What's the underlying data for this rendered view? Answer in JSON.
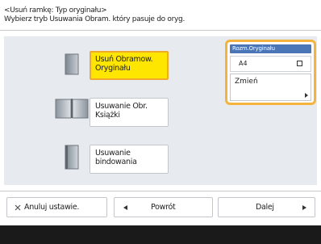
{
  "header": {
    "line1": "<Usuń ramkę: Typ oryginału>",
    "line2": "Wybierz tryb Usuwania Obram. który pasuje do oryg."
  },
  "modes": [
    {
      "line1": "Usuń Obramow.",
      "line2": "Oryginału",
      "selected": true
    },
    {
      "line1": "Usuwanie Obr.",
      "line2": "Książki",
      "selected": false
    },
    {
      "line1": "Usuwanie",
      "line2": "bindowania",
      "selected": false
    }
  ],
  "info": {
    "title": "Rozm.Oryginału",
    "size": "A4",
    "change_label": "Zmień"
  },
  "footer": {
    "cancel_label": "Anuluj ustawie.",
    "back_label": "Powrót",
    "next_label": "Dalej"
  },
  "colors": {
    "selected_fill": "#ffe600",
    "selected_border": "#f0a92c",
    "panel_bg": "#e7eaee",
    "info_header": "#4a76b8",
    "info_border": "#f3b33c"
  }
}
